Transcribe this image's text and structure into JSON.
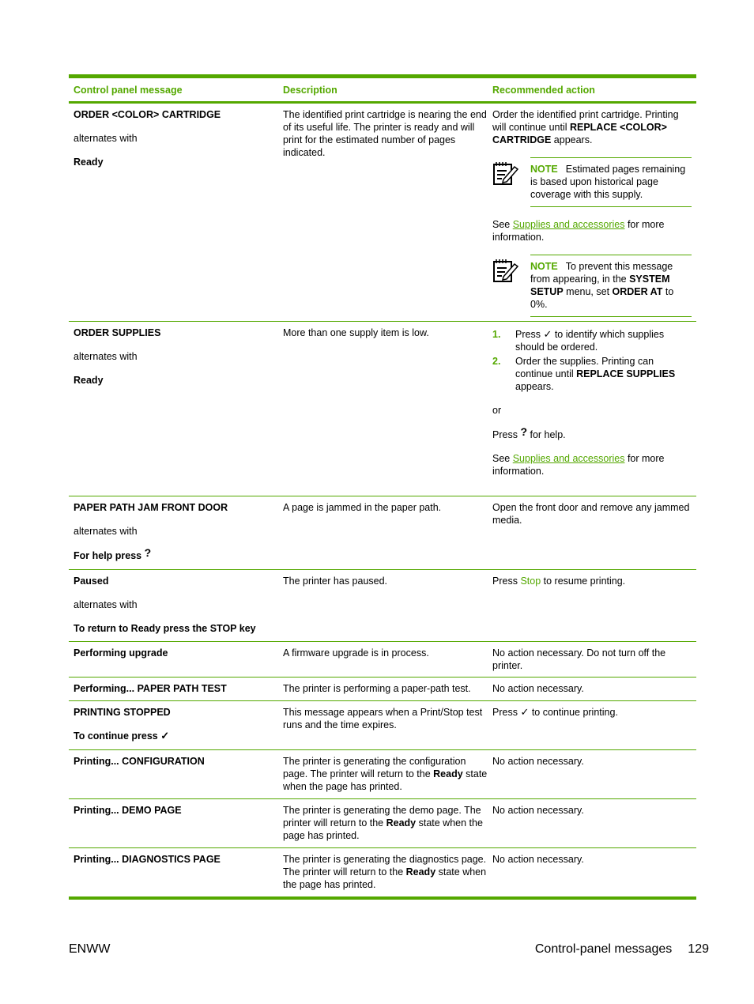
{
  "table": {
    "headers": [
      "Control panel message",
      "Description",
      "Recommended action"
    ],
    "rows": [
      {
        "message": [
          "ORDER <COLOR> CARTRIDGE",
          "alternates with",
          "Ready"
        ],
        "description": "The identified print cartridge is nearing the end of its useful life. The printer is ready and will print for the estimated number of pages indicated.",
        "action": {
          "text1": "Order the identified print cartridge. Printing will continue until ",
          "bold1": "REPLACE <COLOR> CARTRIDGE",
          "text2": " appears.",
          "note1_label": "NOTE",
          "note1_text": "Estimated pages remaining is based upon historical page coverage with this supply.",
          "see_pre": "See ",
          "see_link": "Supplies and accessories",
          "see_post": " for more information.",
          "note2_label": "NOTE",
          "note2_t1": "To prevent this message from appearing, in the ",
          "note2_b1": "SYSTEM SETUP",
          "note2_t2": " menu, set ",
          "note2_b2": "ORDER AT",
          "note2_t3": " to 0%."
        }
      },
      {
        "message": [
          "ORDER SUPPLIES",
          "alternates with",
          "Ready"
        ],
        "description": "More than one supply item is low.",
        "action": {
          "step1_num": "1.",
          "step1_pre": "Press ",
          "step1_post": " to identify which supplies should be ordered.",
          "step2_num": "2.",
          "step2_pre": "Order the supplies. Printing can continue until ",
          "step2_bold": "REPLACE SUPPLIES",
          "step2_post": " appears.",
          "or": "or",
          "help_pre": "Press ",
          "help_post": " for help.",
          "see_pre": "See ",
          "see_link": "Supplies and accessories",
          "see_post": " for more information."
        }
      },
      {
        "message": [
          "PAPER PATH JAM FRONT DOOR",
          "alternates with",
          "For help press "
        ],
        "description": "A page is jammed in the paper path.",
        "action": "Open the front door and remove any jammed media."
      },
      {
        "message": [
          "Paused",
          "alternates with",
          "To return to Ready press the STOP key"
        ],
        "description": "The printer has paused.",
        "action": {
          "pre": "Press ",
          "key": "Stop",
          "post": " to resume printing."
        }
      },
      {
        "message": [
          "Performing upgrade"
        ],
        "description": "A firmware upgrade is in process.",
        "action": "No action necessary. Do not turn off the printer."
      },
      {
        "message": [
          "Performing... PAPER PATH TEST"
        ],
        "description": "The printer is performing a paper-path test.",
        "action": "No action necessary."
      },
      {
        "message": [
          "PRINTING STOPPED",
          "To continue press "
        ],
        "description": "This message appears when a Print/Stop test runs and the time expires.",
        "action": {
          "pre": "Press ",
          "post": " to continue printing."
        }
      },
      {
        "message": [
          "Printing... CONFIGURATION"
        ],
        "description": {
          "pre": "The printer is generating the configuration page. The printer will return to the ",
          "bold": "Ready",
          "post": " state when the page has printed."
        },
        "action": "No action necessary."
      },
      {
        "message": [
          "Printing... DEMO PAGE"
        ],
        "description": {
          "pre": "The printer is generating the demo page. The printer will return to the ",
          "bold": "Ready",
          "post": " state when the page has printed."
        },
        "action": "No action necessary."
      },
      {
        "message": [
          "Printing... DIAGNOSTICS PAGE"
        ],
        "description": {
          "pre": "The printer is generating the diagnostics page. The printer will return to the ",
          "bold": "Ready",
          "post": " state when the page has printed."
        },
        "action": "No action necessary."
      }
    ]
  },
  "icons": {
    "check": "✓",
    "help": "?"
  },
  "footer": {
    "left": "ENWW",
    "section": "Control-panel messages",
    "page": "129"
  }
}
